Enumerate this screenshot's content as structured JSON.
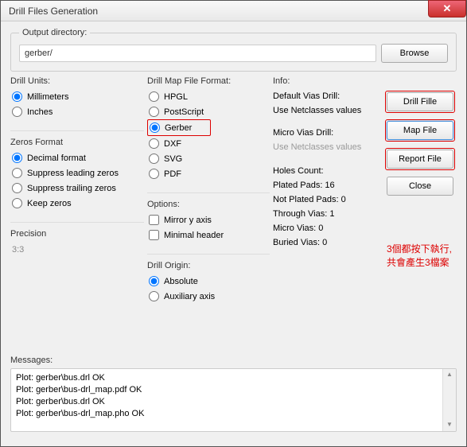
{
  "window": {
    "title": "Drill Files Generation"
  },
  "output": {
    "legend": "Output directory:",
    "value": "gerber/",
    "browse": "Browse"
  },
  "drillUnits": {
    "label": "Drill Units:",
    "options": {
      "mm": "Millimeters",
      "in": "Inches"
    }
  },
  "zeros": {
    "label": "Zeros Format",
    "options": {
      "decimal": "Decimal format",
      "supLead": "Suppress leading zeros",
      "supTrail": "Suppress trailing zeros",
      "keep": "Keep zeros"
    }
  },
  "precision": {
    "label": "Precision",
    "value": "3:3"
  },
  "mapFormat": {
    "label": "Drill Map File Format:",
    "options": {
      "hpgl": "HPGL",
      "ps": "PostScript",
      "gerber": "Gerber",
      "dxf": "DXF",
      "svg": "SVG",
      "pdf": "PDF"
    }
  },
  "options": {
    "label": "Options:",
    "mirror": "Mirror y axis",
    "minimal": "Minimal header"
  },
  "origin": {
    "label": "Drill Origin:",
    "abs": "Absolute",
    "aux": "Auxiliary axis"
  },
  "info": {
    "label": "Info:",
    "defaultVias": "Default Vias Drill:",
    "useNet1": "Use Netclasses values",
    "microVias": "Micro Vias Drill:",
    "useNet2": "Use Netclasses values",
    "holesLabel": "Holes Count:",
    "plated": "Plated Pads: 16",
    "notPlated": "Not Plated Pads: 0",
    "through": "Through Vias: 1",
    "micro": "Micro Vias: 0",
    "buried": "Buried Vias: 0"
  },
  "buttons": {
    "drill": "Drill Fille",
    "map": "Map File",
    "report": "Report File",
    "close": "Close"
  },
  "annotation": {
    "line1": "3個都按下執行,",
    "line2": "共會產生3檔案"
  },
  "messages": {
    "label": "Messages:",
    "lines": [
      "Plot: gerber\\bus.drl OK",
      "Plot: gerber\\bus-drl_map.pdf OK",
      "Plot: gerber\\bus.drl OK",
      "Plot: gerber\\bus-drl_map.pho OK"
    ]
  }
}
